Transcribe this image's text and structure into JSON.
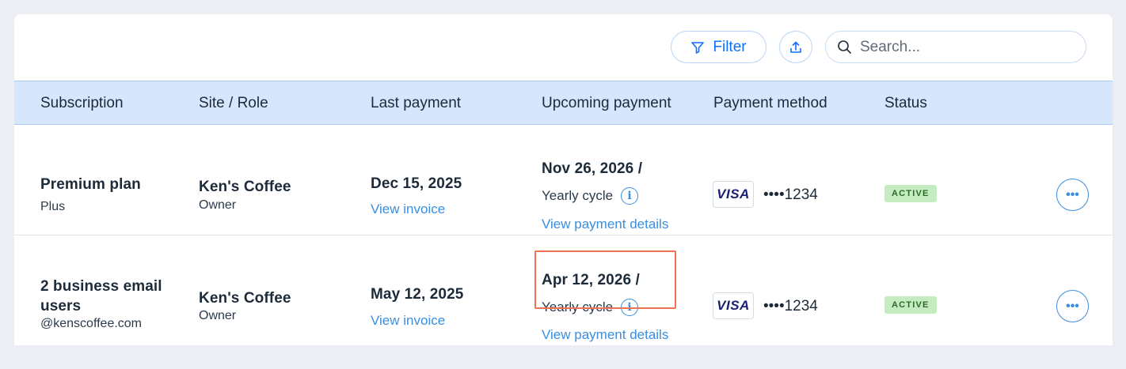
{
  "toolbar": {
    "filter_label": "Filter",
    "search_placeholder": "Search..."
  },
  "columns": [
    "Subscription",
    "Site / Role",
    "Last payment",
    "Upcoming payment",
    "Payment method",
    "Status"
  ],
  "rows": [
    {
      "subscription": "Premium plan",
      "subscription_sub": "Plus",
      "site": "Ken's Coffee",
      "role": "Owner",
      "last_payment": "Dec 15, 2025",
      "view_invoice": "View invoice",
      "upcoming_payment": "Nov 26, 2026 /",
      "cycle": "Yearly cycle",
      "view_details": "View payment details",
      "card_brand": "VISA",
      "card_number": "••••1234",
      "status": "ACTIVE"
    },
    {
      "subscription": "2 business email",
      "subscription_line2": "users",
      "subscription_sub": "@kenscoffee.com",
      "site": "Ken's Coffee",
      "role": "Owner",
      "last_payment": "May 12, 2025",
      "view_invoice": "View invoice",
      "upcoming_payment": "Apr 12, 2026 /",
      "cycle": "Yearly cycle",
      "view_details": "View payment details",
      "card_brand": "VISA",
      "card_number": "••••1234",
      "status": "ACTIVE"
    }
  ],
  "icons": {
    "info": "i",
    "more": "•••"
  },
  "colors": {
    "accent": "#116dff",
    "link": "#3b8ede",
    "header_bg": "#d6e6fc",
    "badge_bg": "#c5ecc0",
    "badge_text": "#2b6b25",
    "highlight": "#ef7254"
  }
}
